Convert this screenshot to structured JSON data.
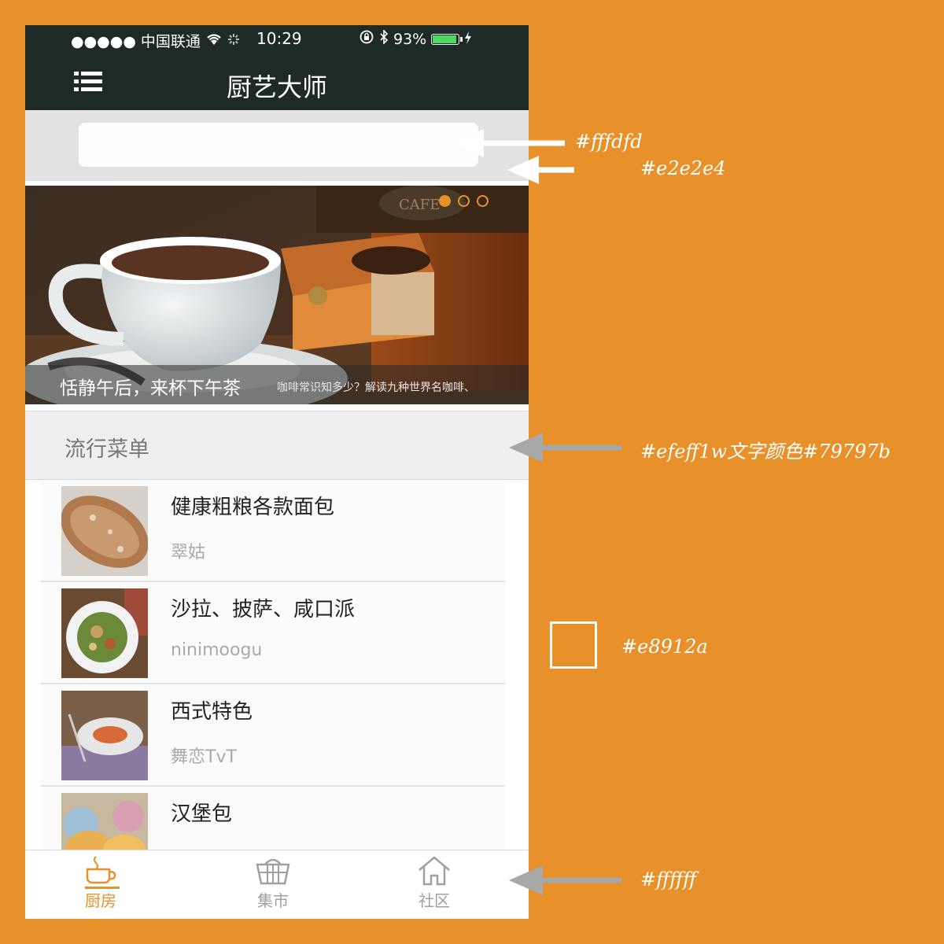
{
  "status_bar": {
    "carrier": "●●●●● 中国联通",
    "time": "10:29",
    "battery": "93%",
    "battery_level": 0.93
  },
  "nav": {
    "title": "厨艺大师",
    "menu_icon": "list-icon"
  },
  "search": {
    "placeholder": ""
  },
  "banner": {
    "title": "恬静午后，来杯下午茶",
    "subtitle": "咖啡常识知多少？解读九种世界名咖啡、",
    "page_count": 3,
    "active_page": 0
  },
  "section": {
    "title": "流行菜单"
  },
  "recipes": [
    {
      "title": "健康粗粮各款面包",
      "author": "翠姑"
    },
    {
      "title": "沙拉、披萨、咸口派",
      "author": "ninimoogu"
    },
    {
      "title": "西式特色",
      "author": "舞恋TvT"
    },
    {
      "title": "汉堡包",
      "author": ""
    }
  ],
  "tabs": [
    {
      "label": "厨房",
      "icon": "coffee-cup-icon",
      "active": true
    },
    {
      "label": "集市",
      "icon": "basket-icon",
      "active": false
    },
    {
      "label": "社区",
      "icon": "home-icon",
      "active": false
    }
  ],
  "annotations": {
    "search_field_color": "#fffdfd",
    "search_bg_color": "#e2e2e4",
    "section_header_note": "#efeff1w文字颜色#79797b",
    "page_bg_color": "#e8912a",
    "tabbar_color": "#ffffff"
  },
  "colors": {
    "accent": "#e8912a",
    "nav_bg": "#1d2a27",
    "section_text": "#79797b",
    "section_bg": "#efeff1"
  }
}
